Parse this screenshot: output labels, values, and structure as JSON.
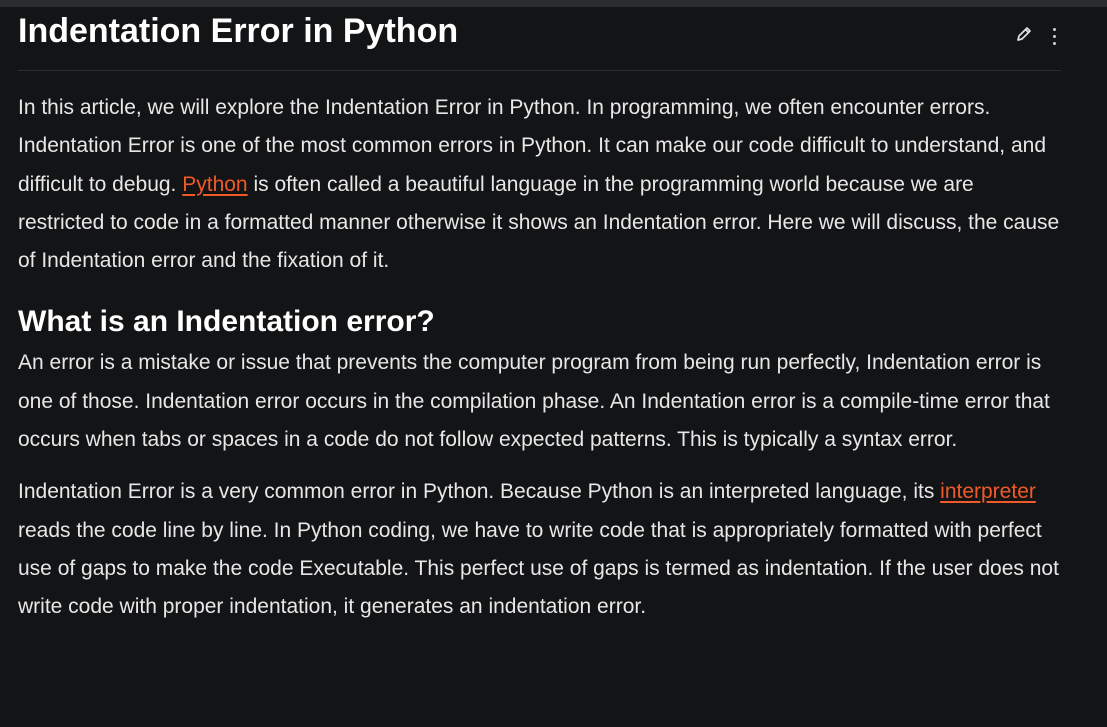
{
  "article": {
    "title": "Indentation Error in Python",
    "actions": {
      "edit_icon": "pencil-icon",
      "more_icon": "kebab-icon"
    },
    "intro": {
      "before_link": "In this article, we will explore the Indentation Error in Python. In programming, we often encounter errors. Indentation Error is one of the most common errors in Python. It can make our code difficult to understand, and difficult to debug. ",
      "link_text": "Python",
      "after_link": " is often called a beautiful language in the programming world because we are restricted to code in a formatted manner otherwise it shows an Indentation error. Here we will discuss, the cause of Indentation error and the fixation of it."
    },
    "section_heading": "What is an Indentation error?",
    "para2": "An error is a mistake or issue that prevents the computer program from being run perfectly, Indentation error is one of those. Indentation error occurs in the compilation phase. An Indentation error is a compile-time error that occurs when tabs or spaces in a code do not follow expected patterns. This is typically a syntax error.",
    "para3": {
      "before_link": "Indentation Error is a very common error in Python. Because Python is an interpreted language, its ",
      "link_text": "interpreter",
      "after_link": " reads the code line by line. In Python coding, we have to write code that is appropriately formatted with perfect use of gaps to make the code Executable. This perfect use of gaps is termed as indentation. If the user does not write code with proper indentation, it generates an indentation error."
    }
  },
  "colors": {
    "background": "#131416",
    "text": "#e7e7e7",
    "heading": "#ffffff",
    "link": "#f05a28",
    "divider": "#2b2c2e"
  }
}
